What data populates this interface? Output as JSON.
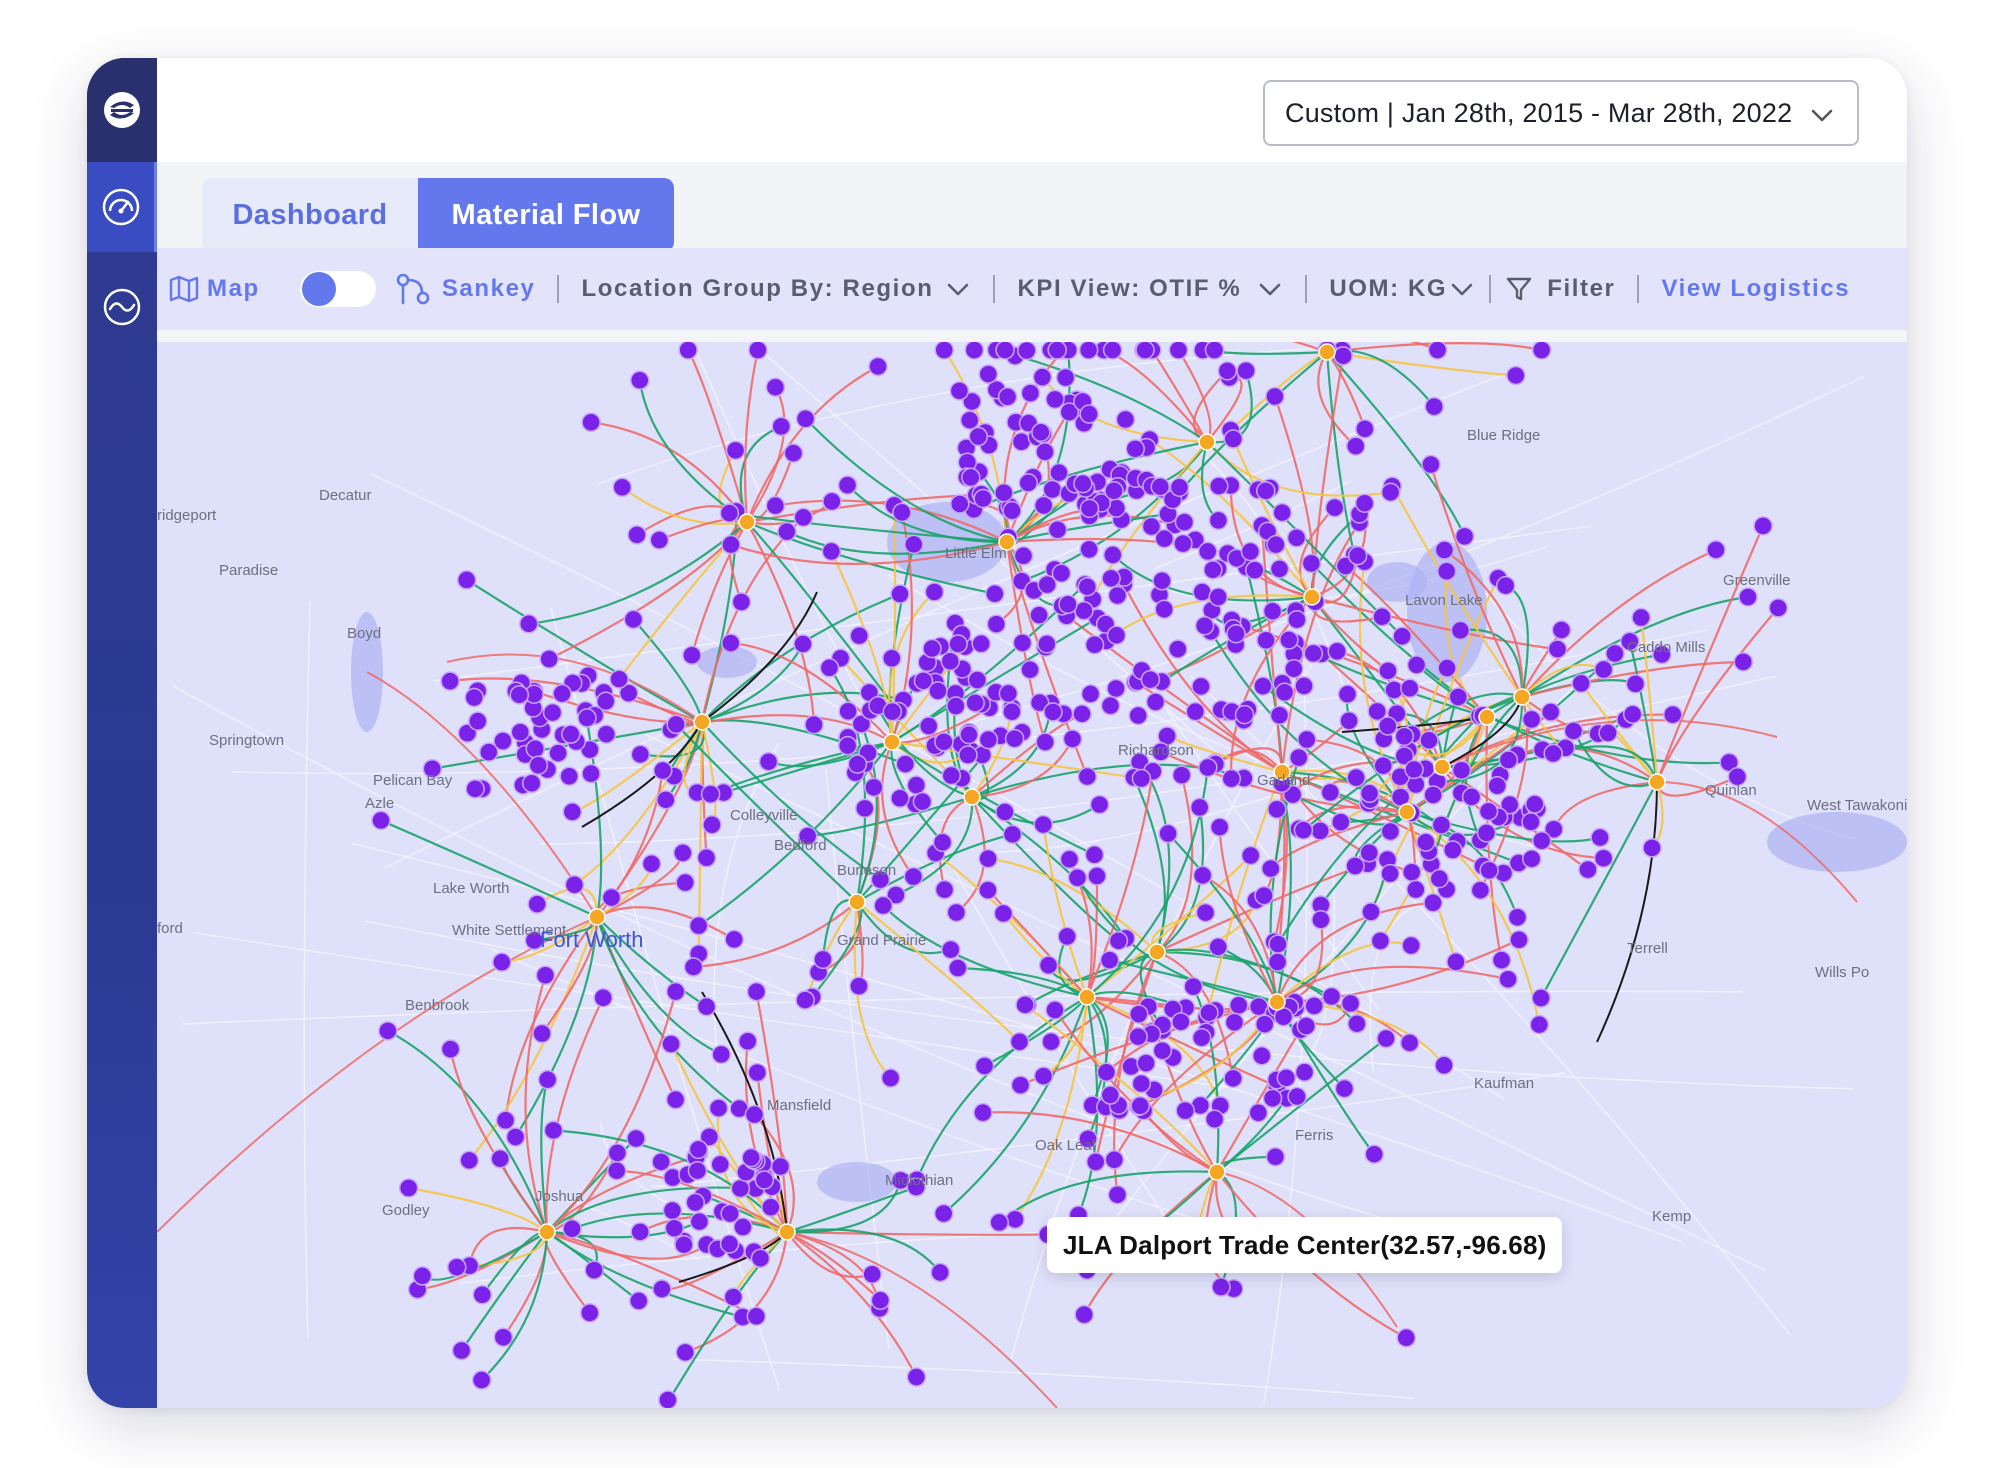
{
  "header": {
    "date_range": "Custom | Jan 28th, 2015 - Mar 28th, 2022"
  },
  "tabs": [
    {
      "label": "Dashboard",
      "active": false
    },
    {
      "label": "Material Flow",
      "active": true
    }
  ],
  "toolbar": {
    "map_label": "Map",
    "sankey_label": "Sankey",
    "location_group": "Location Group By: Region",
    "kpi_view": "KPI View: OTIF %",
    "uom": "UOM: KG",
    "filter_label": "Filter",
    "view_logistics": "View Logistics",
    "view_toggle_on": false
  },
  "map": {
    "tooltip": "JLA Dalport Trade Center(32.57,-96.68)",
    "places": [
      {
        "name": "Decatur"
      },
      {
        "name": "ridgeport"
      },
      {
        "name": "Paradise"
      },
      {
        "name": "Boyd"
      },
      {
        "name": "Springtown"
      },
      {
        "name": "Pelican Bay"
      },
      {
        "name": "Azle"
      },
      {
        "name": "Lake Worth"
      },
      {
        "name": "White Settlement"
      },
      {
        "name": "Fort Worth"
      },
      {
        "name": "ford"
      },
      {
        "name": "Benbrook"
      },
      {
        "name": "Colleyville"
      },
      {
        "name": "Bedford"
      },
      {
        "name": "Little Elm"
      },
      {
        "name": "Blue Ridge"
      },
      {
        "name": "Greenville"
      },
      {
        "name": "Lavon Lake"
      },
      {
        "name": "Caddo Mills"
      },
      {
        "name": "Quinlan"
      },
      {
        "name": "West Tawakoni"
      },
      {
        "name": "Richardson"
      },
      {
        "name": "Garland"
      },
      {
        "name": "Terrell"
      },
      {
        "name": "Wills Po"
      },
      {
        "name": "Kaufman"
      },
      {
        "name": "Ferris"
      },
      {
        "name": "Oak Leaf"
      },
      {
        "name": "Midlothian"
      },
      {
        "name": "Godley"
      },
      {
        "name": "Joshua"
      },
      {
        "name": "Kemp"
      },
      {
        "name": "Grand Prairie"
      },
      {
        "name": "Mansfield"
      },
      {
        "name": "Burleson"
      }
    ],
    "colors": {
      "site": "#7b22e8",
      "hub": "#f5a623",
      "flow_red": "#f06a6a",
      "flow_yellow": "#f5c542",
      "flow_green": "#1aa36b",
      "flow_black": "#1a1a1a",
      "background": "#dfe0f9",
      "water": "#aeb2f4"
    }
  }
}
